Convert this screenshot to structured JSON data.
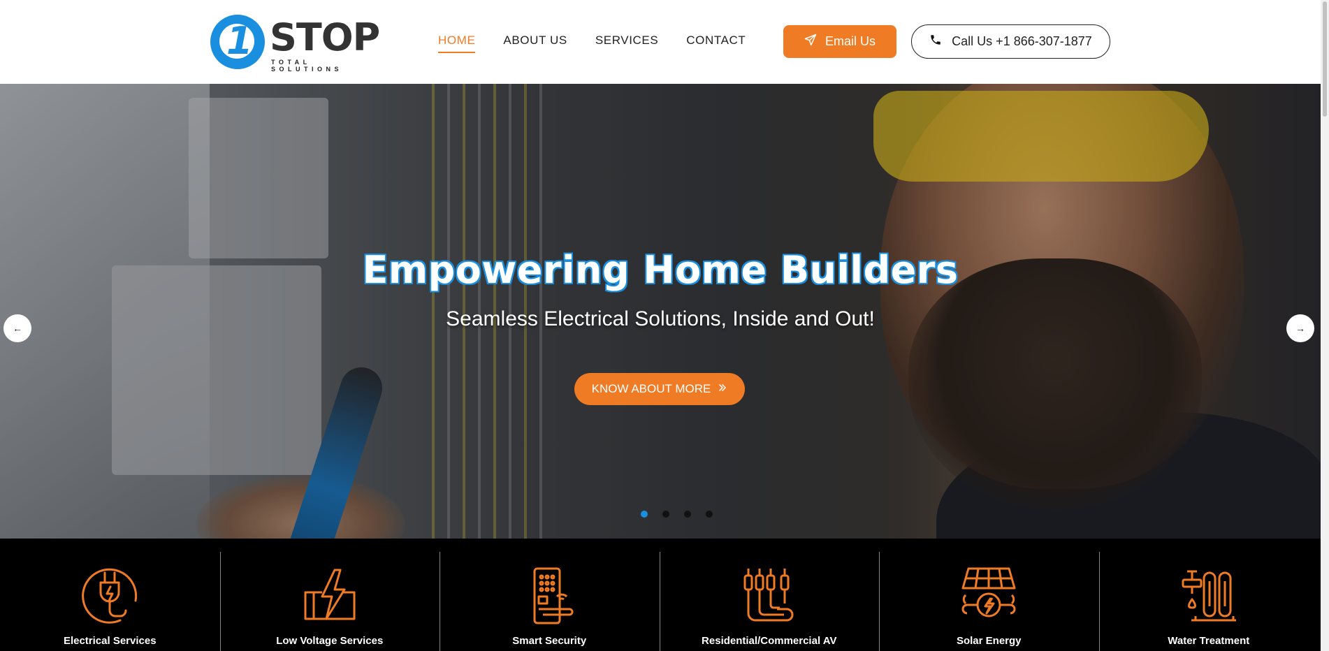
{
  "brand": {
    "logo_number": "1",
    "logo_word": "STOP",
    "logo_tagline": "TOTAL SOLUTIONS",
    "primary_color": "#1a8fe0",
    "accent_color": "#f07b25"
  },
  "nav": {
    "items": [
      {
        "label": "HOME",
        "active": true
      },
      {
        "label": "ABOUT US",
        "active": false
      },
      {
        "label": "SERVICES",
        "active": false
      },
      {
        "label": "CONTACT",
        "active": false
      }
    ]
  },
  "header_actions": {
    "email_label": "Email Us",
    "email_icon": "paper-plane-icon",
    "call_label": "Call Us +1 866-307-1877",
    "call_icon": "phone-icon"
  },
  "hero": {
    "title": "Empowering Home Builders",
    "subtitle": "Seamless Electrical Solutions, Inside and Out!",
    "cta_label": "KNOW ABOUT MORE",
    "cta_icon": "double-chevron-right-icon",
    "prev_arrow": "←",
    "next_arrow": "→",
    "slide_count": 4,
    "active_slide": 1
  },
  "services": [
    {
      "label": "Electrical Services",
      "icon": "plug-icon"
    },
    {
      "label": "Low Voltage Services",
      "icon": "lightning-box-icon"
    },
    {
      "label": "Smart Security",
      "icon": "smart-lock-icon"
    },
    {
      "label": "Residential/Commercial AV",
      "icon": "av-cables-icon"
    },
    {
      "label": "Solar Energy",
      "icon": "solar-panel-icon"
    },
    {
      "label": "Water Treatment",
      "icon": "water-filter-icon"
    }
  ]
}
